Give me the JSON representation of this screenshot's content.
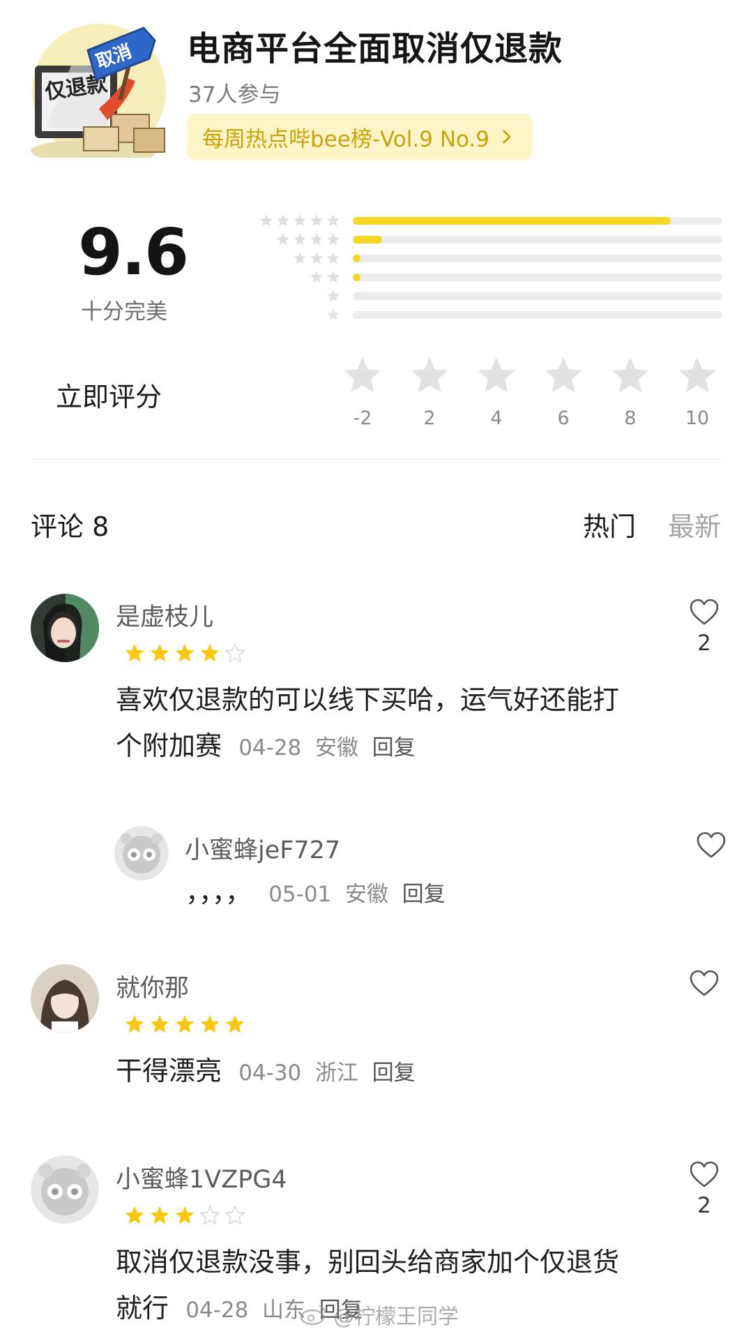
{
  "topic": {
    "cover_text": "取消",
    "cover_sign": "仅退款",
    "title": "电商平台全面取消仅退款",
    "participants": "37人参与",
    "ranking": "每周热点哔bee榜-Vol.9 No.9"
  },
  "score": {
    "value": "9.6",
    "label": "十分完美",
    "distribution": [
      {
        "stars": 5,
        "fraction": 0.86
      },
      {
        "stars": 4,
        "fraction": 0.08
      },
      {
        "stars": 3,
        "fraction": 0.02
      },
      {
        "stars": 2,
        "fraction": 0.02
      },
      {
        "stars": 1,
        "fraction": 0.0
      },
      {
        "stars": 0,
        "fraction": 0.0
      }
    ]
  },
  "rate": {
    "label": "立即评分",
    "options": [
      "-2",
      "2",
      "4",
      "6",
      "8",
      "10"
    ]
  },
  "comments_header": {
    "title": "评论 8",
    "sort_hot": "热门",
    "sort_new": "最新"
  },
  "comments": [
    {
      "name": "是虚枝儿",
      "stars": 4,
      "text_line1": "喜欢仅退款的可以线下买哈，运气好还能打",
      "text_line2": "个附加赛",
      "date": "04-28",
      "region": "安徽",
      "reply": "回复",
      "likes": "2"
    },
    {
      "name": "小蜜蜂jeF727",
      "text": "，，，，",
      "date": "05-01",
      "region": "安徽",
      "reply": "回复",
      "likes": ""
    },
    {
      "name": "就你那",
      "stars": 5,
      "text": "干得漂亮",
      "date": "04-30",
      "region": "浙江",
      "reply": "回复",
      "likes": ""
    },
    {
      "name": "小蜜蜂1VZPG4",
      "stars": 3,
      "text_line1": "取消仅退款没事，别回头给商家加个仅退货",
      "text_line2": "就行",
      "date": "04-28",
      "region": "山东",
      "reply": "回复",
      "likes": "2"
    }
  ],
  "watermark": "@柠檬王同学",
  "colors": {
    "accent": "#f7d723",
    "pill_bg": "#fdf4c7",
    "pill_text": "#c9a30a",
    "track": "#ececec",
    "muted": "#8a8a8a"
  },
  "icons": [
    "star-icon",
    "heart-icon",
    "chevron-right-icon",
    "weibo-icon"
  ]
}
